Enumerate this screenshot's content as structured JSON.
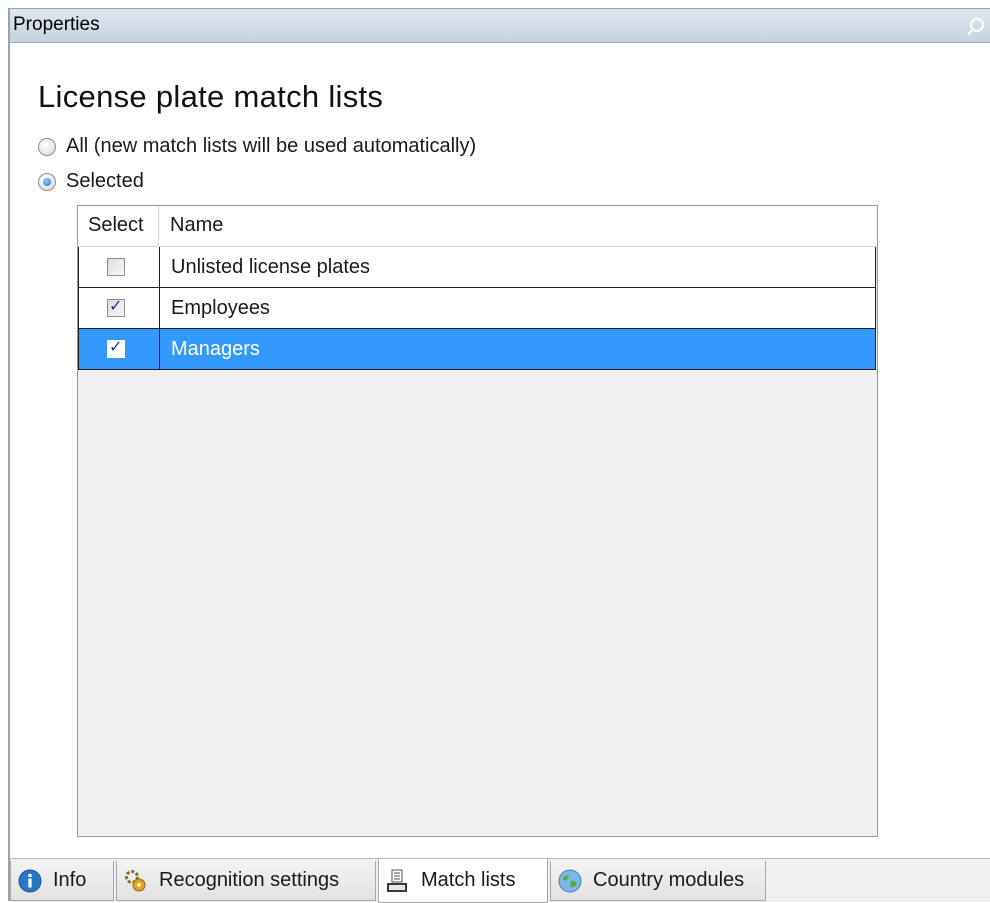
{
  "window": {
    "title": "Properties"
  },
  "section": {
    "heading": "License plate match lists"
  },
  "radios": [
    {
      "label": "All (new match lists will be used automatically)",
      "checked": false
    },
    {
      "label": "Selected",
      "checked": true
    }
  ],
  "grid": {
    "columns": {
      "select": "Select",
      "name": "Name"
    },
    "rows": [
      {
        "name": "Unlisted license plates",
        "checked": false,
        "selected": false
      },
      {
        "name": "Employees",
        "checked": true,
        "selected": false
      },
      {
        "name": "Managers",
        "checked": true,
        "selected": true
      }
    ],
    "selection_color": "#3399ff"
  },
  "tabs": [
    {
      "label": "Info",
      "icon": "info-icon",
      "active": false
    },
    {
      "label": "Recognition settings",
      "icon": "settings-gear-icon",
      "active": false
    },
    {
      "label": "Match lists",
      "icon": "match-list-icon",
      "active": true
    },
    {
      "label": "Country modules",
      "icon": "globe-icon",
      "active": false
    }
  ]
}
